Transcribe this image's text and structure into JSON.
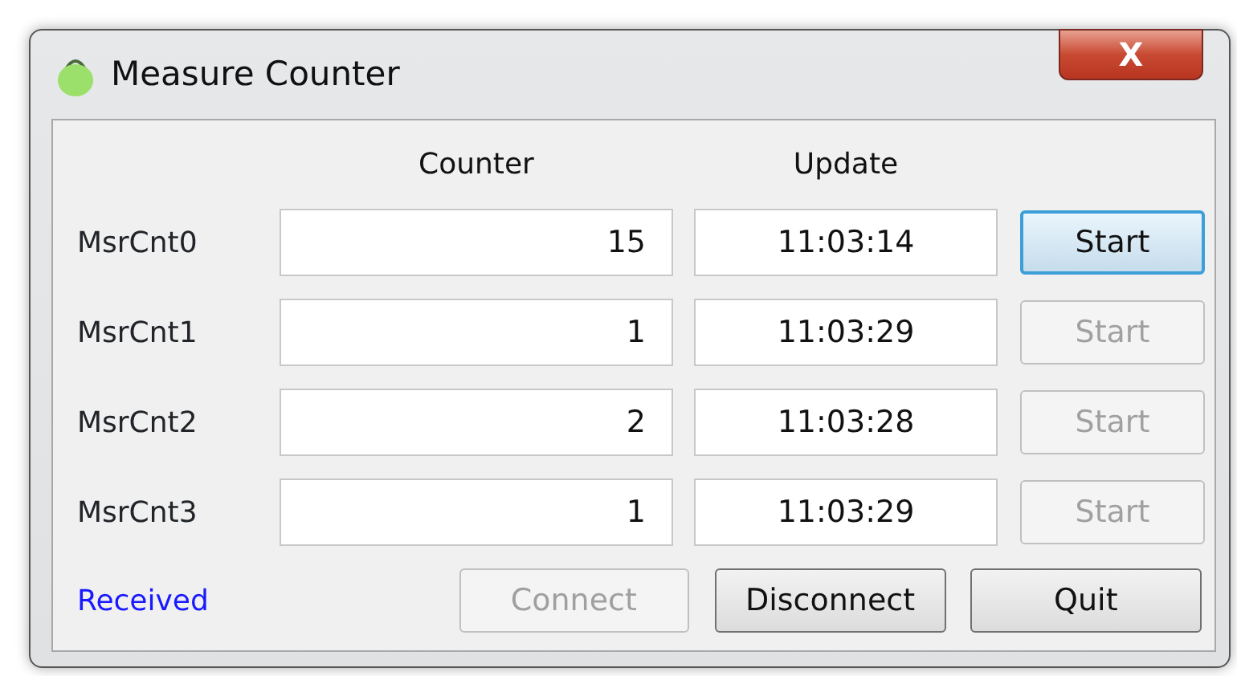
{
  "window": {
    "title": "Measure Counter",
    "close_label": "X"
  },
  "columns": [
    "Counter",
    "Update"
  ],
  "rows": [
    {
      "label": "MsrCnt0",
      "counter": "15",
      "update": "11:03:14",
      "button": {
        "label": "Start",
        "disabled": false,
        "focused": true
      }
    },
    {
      "label": "MsrCnt1",
      "counter": "1",
      "update": "11:03:29",
      "button": {
        "label": "Start",
        "disabled": true,
        "focused": false
      }
    },
    {
      "label": "MsrCnt2",
      "counter": "2",
      "update": "11:03:28",
      "button": {
        "label": "Start",
        "disabled": true,
        "focused": false
      }
    },
    {
      "label": "MsrCnt3",
      "counter": "1",
      "update": "11:03:29",
      "button": {
        "label": "Start",
        "disabled": true,
        "focused": false
      }
    }
  ],
  "status": "Received",
  "buttons": [
    {
      "label": "Connect",
      "disabled": true
    },
    {
      "label": "Disconnect",
      "disabled": false
    },
    {
      "label": "Quit",
      "disabled": false
    }
  ]
}
